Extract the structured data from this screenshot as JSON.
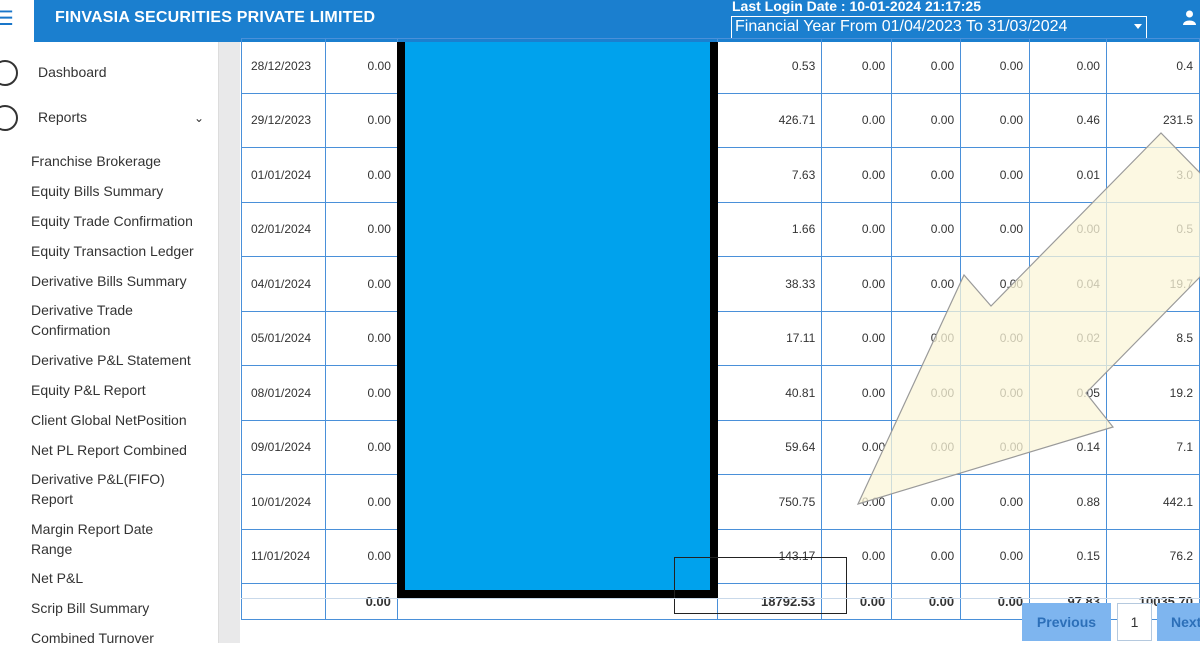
{
  "header": {
    "company": "FINVASIA SECURITIES PRIVATE LIMITED",
    "last_login": "Last Login Date : 10-01-2024 21:17:25",
    "financial_year": "Financial Year From 01/04/2023 To 31/03/2024"
  },
  "sidebar": {
    "dashboard": "Dashboard",
    "reports": "Reports",
    "items": [
      "Franchise Brokerage",
      "Equity Bills Summary",
      "Equity Trade Confirmation",
      "Equity Transaction Ledger",
      "Derivative Bills Summary",
      "Derivative Trade Confirmation",
      "Derivative P&L Statement",
      "Equity P&L Report",
      "Client Global NetPosition",
      "Net PL Report Combined",
      "Derivative P&L(FIFO) Report",
      "Margin Report Date Range",
      "Net P&L",
      "Scrip Bill Summary",
      "Combined Turnover"
    ]
  },
  "table": {
    "rows": [
      [
        "28/12/2023",
        "0.00",
        "0.53",
        "0.00",
        "0.00",
        "0.00",
        "0.00",
        "0.4"
      ],
      [
        "29/12/2023",
        "0.00",
        "426.71",
        "0.00",
        "0.00",
        "0.00",
        "0.46",
        "231.5"
      ],
      [
        "01/01/2024",
        "0.00",
        "7.63",
        "0.00",
        "0.00",
        "0.00",
        "0.01",
        "3.0"
      ],
      [
        "02/01/2024",
        "0.00",
        "1.66",
        "0.00",
        "0.00",
        "0.00",
        "0.00",
        "0.5"
      ],
      [
        "04/01/2024",
        "0.00",
        "38.33",
        "0.00",
        "0.00",
        "0.00",
        "0.04",
        "19.7"
      ],
      [
        "05/01/2024",
        "0.00",
        "17.11",
        "0.00",
        "0.00",
        "0.00",
        "0.02",
        "8.5"
      ],
      [
        "08/01/2024",
        "0.00",
        "40.81",
        "0.00",
        "0.00",
        "0.00",
        "0.05",
        "19.2"
      ],
      [
        "09/01/2024",
        "0.00",
        "59.64",
        "0.00",
        "0.00",
        "0.00",
        "0.14",
        "7.1"
      ],
      [
        "10/01/2024",
        "0.00",
        "750.75",
        "0.00",
        "0.00",
        "0.00",
        "0.88",
        "442.1"
      ],
      [
        "11/01/2024",
        "0.00",
        "143.17",
        "0.00",
        "0.00",
        "0.00",
        "0.15",
        "76.2"
      ]
    ],
    "totals": [
      "",
      "0.00",
      "18792.53",
      "0.00",
      "0.00",
      "0.00",
      "97.83",
      "10035.70"
    ]
  },
  "pager": {
    "previous": "Previous",
    "page": "1",
    "next": "Next"
  },
  "colors": {
    "header_bg": "#1b7fcf",
    "redaction": "#00a2ed",
    "grid_border": "#4a90d9",
    "pager_button": "#7eb5ef"
  }
}
